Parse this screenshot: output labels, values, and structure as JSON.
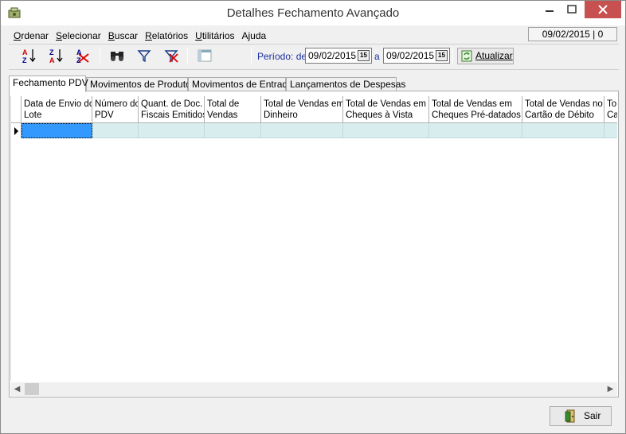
{
  "window": {
    "title": "Detalhes Fechamento Avançado"
  },
  "menu": {
    "items": [
      {
        "u": "O",
        "rest": "rdenar"
      },
      {
        "u": "S",
        "rest": "elecionar"
      },
      {
        "u": "B",
        "rest": "uscar"
      },
      {
        "u": "R",
        "rest": "elatórios"
      },
      {
        "u": "U",
        "rest": "tilitários"
      },
      {
        "u": "",
        "rest": "Ajuda"
      }
    ],
    "date_status": "09/02/2015 | 0"
  },
  "toolbar": {
    "periodo_label": "Período: de",
    "a_label": "a",
    "date_from": "09/02/2015",
    "date_to": "09/02/2015",
    "calendar_glyph": "15",
    "atualizar_label": "Atualizar"
  },
  "tabs": [
    {
      "label": "Fechamento PDV"
    },
    {
      "label": "Movimentos de Produtos"
    },
    {
      "label": "Movimentos de Entrada"
    },
    {
      "label": "Lançamentos de Despesas"
    }
  ],
  "grid": {
    "columns": [
      {
        "l1": "Data de Envio do",
        "l2": "Lote"
      },
      {
        "l1": "Número do",
        "l2": "PDV"
      },
      {
        "l1": "Quant. de Doc.",
        "l2": "Fiscais Emitidos"
      },
      {
        "l1": "Total de",
        "l2": "Vendas"
      },
      {
        "l1": "Total de Vendas em",
        "l2": "Dinheiro"
      },
      {
        "l1": "Total de Vendas em",
        "l2": "Cheques à Vista"
      },
      {
        "l1": "Total de Vendas em",
        "l2": "Cheques Pré-datados"
      },
      {
        "l1": "Total de Vendas no",
        "l2": "Cartão de Débito"
      },
      {
        "l1": "To",
        "l2": "Ca"
      }
    ]
  },
  "footer": {
    "sair_label": "Sair"
  },
  "colors": {
    "selection": "#3399ff",
    "row": "#d8eeee",
    "close": "#c75050",
    "label_blue": "#1a2fa0"
  }
}
